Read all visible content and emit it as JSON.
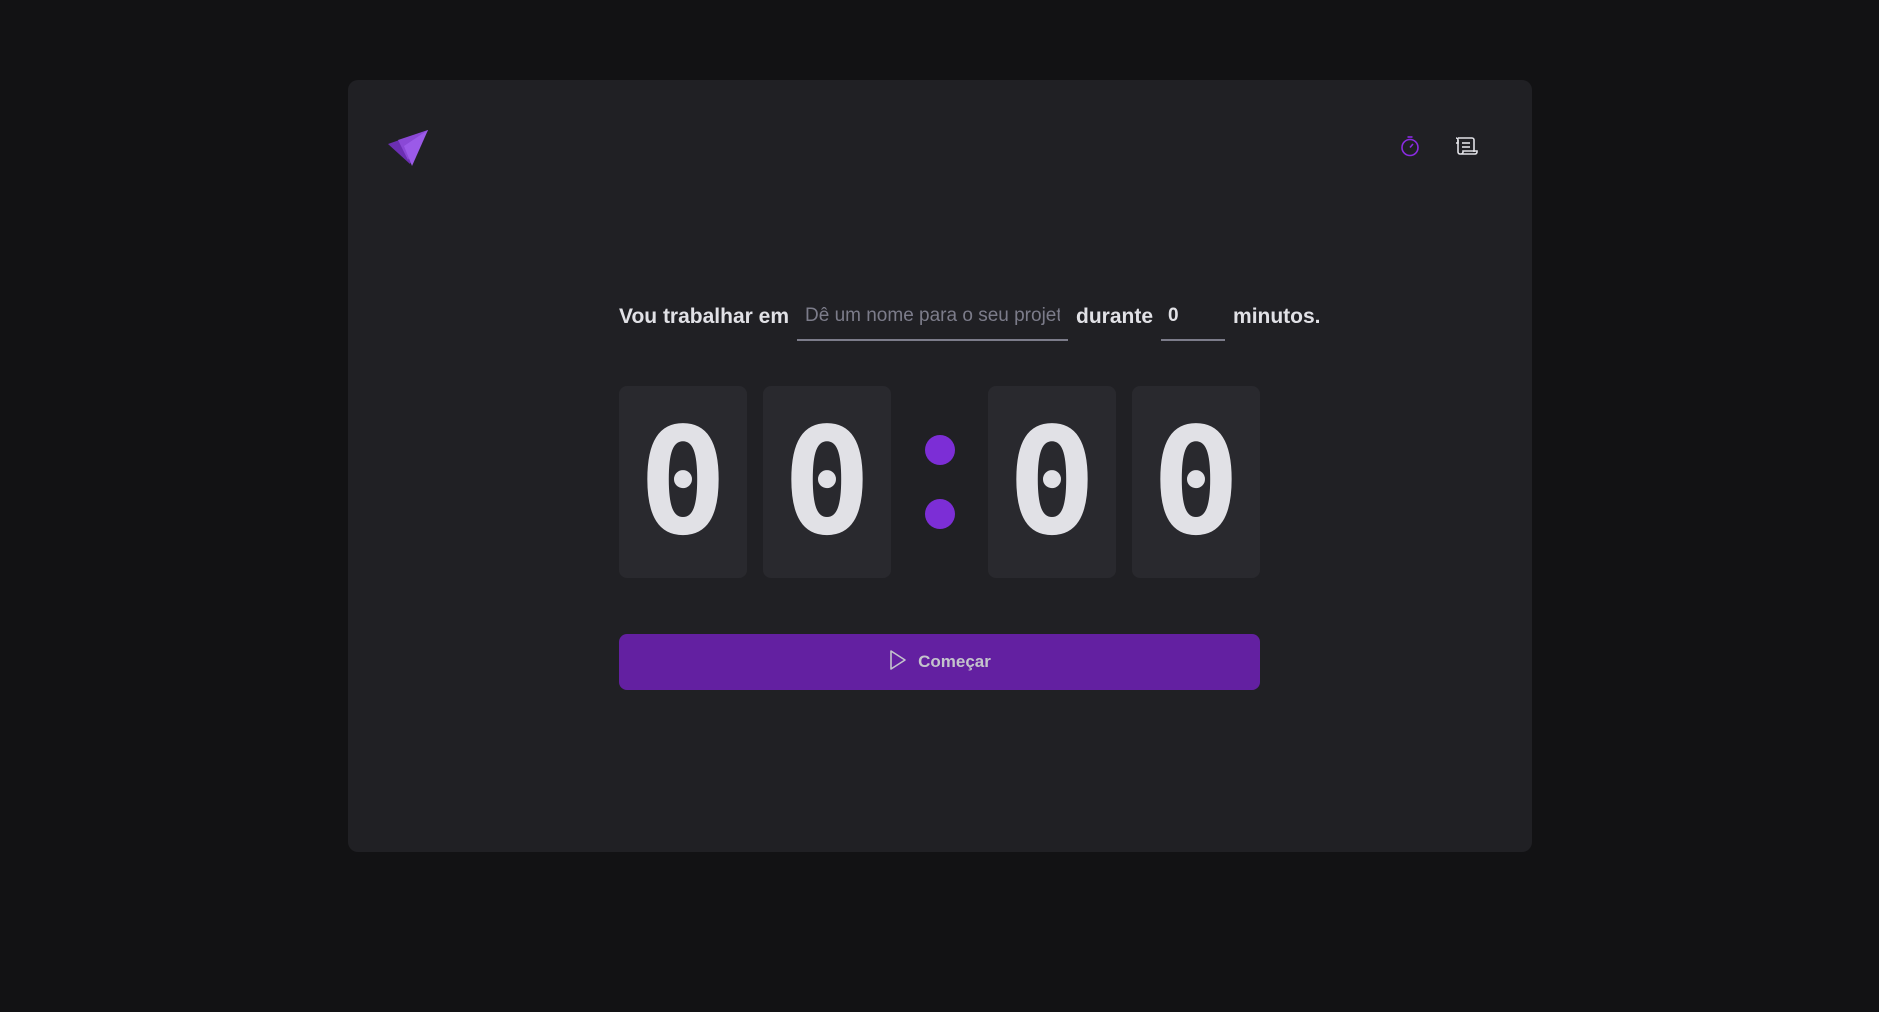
{
  "header": {
    "logo_icon": "triangle-logo-icon",
    "nav": [
      {
        "name": "timer",
        "icon": "timer-icon",
        "color": "#8a2be2"
      },
      {
        "name": "history",
        "icon": "scroll-icon",
        "color": "#e1e1e6"
      }
    ]
  },
  "form": {
    "task_label": "Vou trabalhar em",
    "task_placeholder": "Dê um nome para o seu projeto",
    "task_value": "",
    "during_label": "durante",
    "minutes_value": "0",
    "minutes_suffix": "minutos."
  },
  "countdown": {
    "minutes_tens": "0",
    "minutes_ones": "0",
    "separator": ":",
    "seconds_tens": "0",
    "seconds_ones": "0"
  },
  "start_button": {
    "label": "Começar",
    "icon": "play-icon"
  },
  "colors": {
    "background": "#121214",
    "card": "#202024",
    "digit_box": "#29292e",
    "accent": "#7c2ed6",
    "button": "#6320a1",
    "text": "#e1e1e6",
    "muted": "#7c7c8a"
  }
}
